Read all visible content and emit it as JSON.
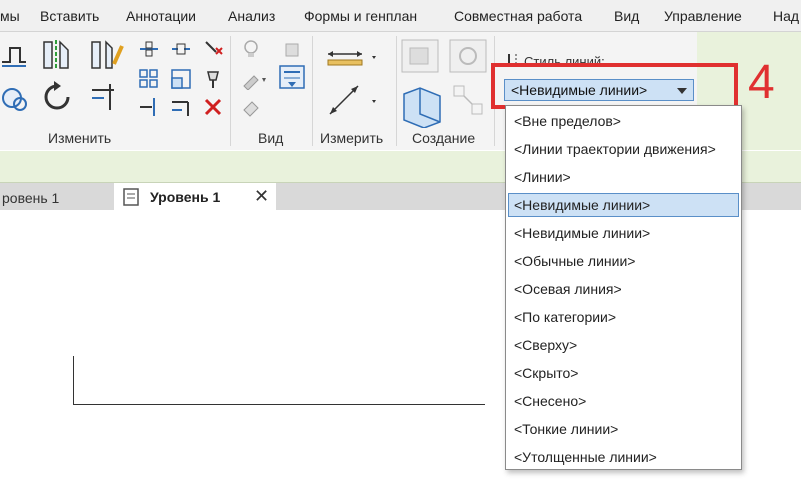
{
  "menu": {
    "items": [
      "мы",
      "Вставить",
      "Аннотации",
      "Анализ",
      "Формы и генплан",
      "Совместная работа",
      "Вид",
      "Управление",
      "Над"
    ]
  },
  "ribbon": {
    "panels": {
      "modify": "Изменить",
      "view": "Вид",
      "measure": "Измерить",
      "create": "Создание"
    },
    "line_style_label": "Стиль линий:",
    "combo_value": "<Невидимые линии>",
    "step_number": "4"
  },
  "tabs": {
    "inactive": "ровень 1",
    "active": "Уровень 1",
    "close": "✕"
  },
  "dropdown": {
    "items": [
      "<Вне пределов>",
      "<Линии траектории движения>",
      "<Линии>",
      "<Невидимые линии>",
      "<Невидимые линии>",
      "<Обычные линии>",
      "<Осевая линия>",
      "<По категории>",
      "<Сверху>",
      "<Скрыто>",
      "<Снесено>",
      "<Тонкие линии>",
      "<Утолщенные линии>"
    ],
    "selected_index": 3
  },
  "colors": {
    "accent_red": "#e03030",
    "selection_bg": "#cde1f5",
    "selection_border": "#5a8fc8",
    "ribbon_green": "#e9f2dc"
  }
}
